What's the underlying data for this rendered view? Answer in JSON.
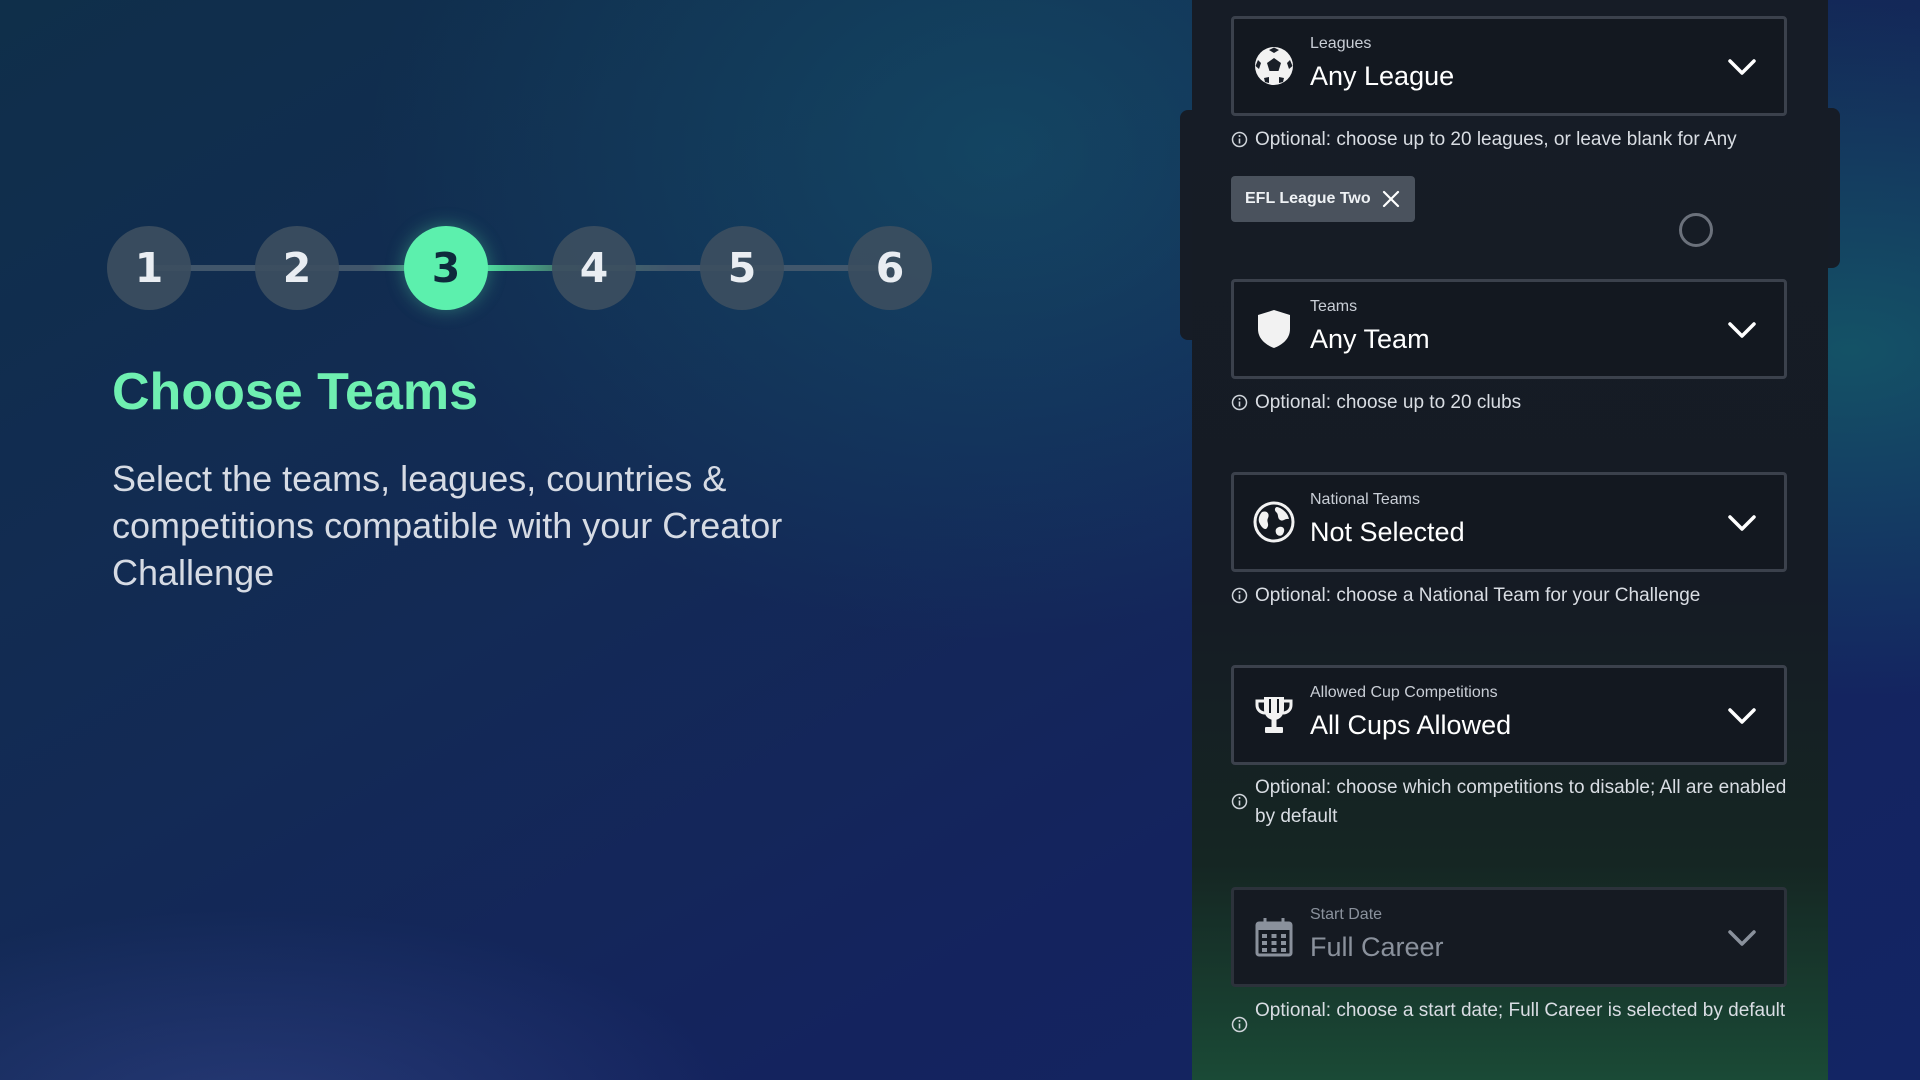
{
  "stepper": {
    "steps": [
      "1",
      "2",
      "3",
      "4",
      "5",
      "6"
    ],
    "active_step": "3"
  },
  "page": {
    "title": "Choose Teams",
    "description": "Select the teams, leagues, countries & competitions compatible with your Creator Challenge"
  },
  "form": {
    "leagues": {
      "label": "Leagues",
      "value": "Any League",
      "icon": "soccer-ball-icon",
      "hint": "Optional: choose up to 20 leagues, or leave blank for Any",
      "chips": [
        {
          "label": "EFL League Two"
        }
      ]
    },
    "teams": {
      "label": "Teams",
      "value": "Any Team",
      "icon": "shield-icon",
      "hint": "Optional: choose up to 20 clubs"
    },
    "national_teams": {
      "label": "National Teams",
      "value": "Not Selected",
      "icon": "globe-icon",
      "hint": "Optional: choose a National Team for your Challenge"
    },
    "cups": {
      "label": "Allowed Cup Competitions",
      "value": "All Cups Allowed",
      "icon": "trophy-icon",
      "hint": "Optional: choose which competitions to disable; All are enabled by default"
    },
    "start_date": {
      "label": "Start Date",
      "value": "Full Career",
      "icon": "calendar-icon",
      "hint": "Optional: choose a start date; Full Career is selected by default"
    }
  },
  "colors": {
    "accent": "#5cf0ad",
    "title": "#6ff0b1",
    "panel": "#161c26"
  }
}
